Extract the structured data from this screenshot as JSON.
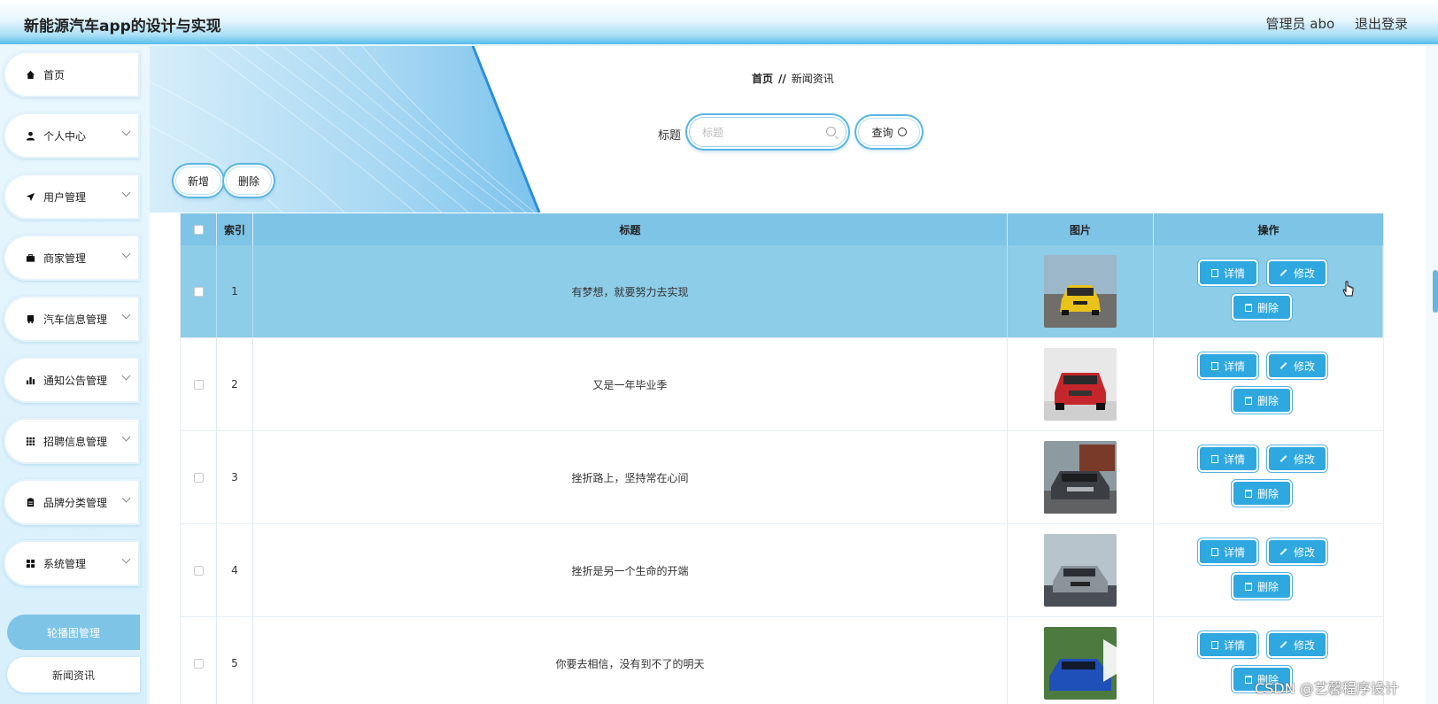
{
  "header": {
    "app_title": "新能源汽车app的设计与实现",
    "admin_label": "管理员 abo",
    "logout_label": "退出登录"
  },
  "sidebar": {
    "items": [
      {
        "label": "首页",
        "icon": "home-icon",
        "expandable": false
      },
      {
        "label": "个人中心",
        "icon": "user-icon",
        "expandable": true
      },
      {
        "label": "用户管理",
        "icon": "send-icon",
        "expandable": true
      },
      {
        "label": "商家管理",
        "icon": "briefcase-icon",
        "expandable": true
      },
      {
        "label": "汽车信息管理",
        "icon": "bus-icon",
        "expandable": true
      },
      {
        "label": "通知公告管理",
        "icon": "bar-chart-icon",
        "expandable": true
      },
      {
        "label": "招聘信息管理",
        "icon": "grid-icon",
        "expandable": true
      },
      {
        "label": "品牌分类管理",
        "icon": "clipboard-icon",
        "expandable": true
      },
      {
        "label": "系统管理",
        "icon": "apps-icon",
        "expandable": true
      }
    ],
    "sub_items": [
      {
        "label": "轮播图管理",
        "active": true
      },
      {
        "label": "新闻资讯",
        "active": false
      }
    ]
  },
  "breadcrumb": {
    "home": "首页",
    "separator": "//",
    "current": "新闻资讯"
  },
  "search": {
    "label": "标题",
    "placeholder": "标题",
    "value": "",
    "button_label": "查询"
  },
  "toolbar": {
    "add_label": "新增",
    "delete_label": "删除"
  },
  "table": {
    "columns": [
      "索引",
      "标题",
      "图片",
      "操作"
    ],
    "rows": [
      {
        "index": "1",
        "title": "有梦想，就要努力去实现",
        "highlighted": true,
        "image": "yellow-car-photo"
      },
      {
        "index": "2",
        "title": "又是一年毕业季",
        "highlighted": false,
        "image": "red-suv-photo"
      },
      {
        "index": "3",
        "title": "挫折路上，坚持常在心间",
        "highlighted": false,
        "image": "grey-sedan-photo"
      },
      {
        "index": "4",
        "title": "挫折是另一个生命的开端",
        "highlighted": false,
        "image": "silver-car-photo"
      },
      {
        "index": "5",
        "title": "你要去相信，没有到不了的明天",
        "highlighted": false,
        "image": "blue-car-photo"
      }
    ],
    "actions": {
      "detail": "详情",
      "edit": "修改",
      "delete": "删除"
    }
  },
  "watermark": "CSDN @艺馨程序设计",
  "colors": {
    "accent": "#7ec4e6",
    "button": "#2fa8e0",
    "header_bottom": "#55bde9"
  }
}
